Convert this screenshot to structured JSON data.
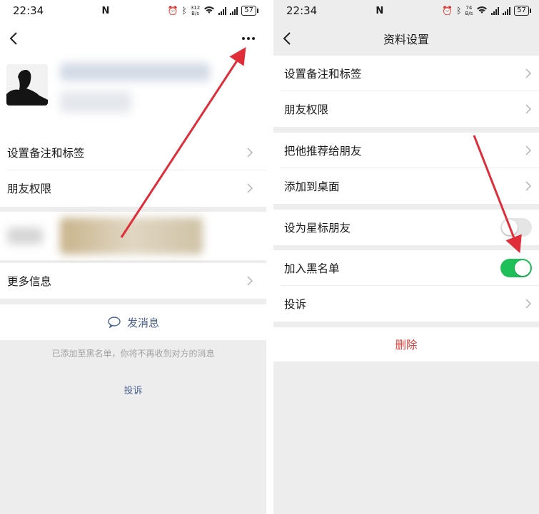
{
  "left_screen": {
    "status": {
      "time": "22:34",
      "speed_value": "312",
      "speed_unit": "B/s",
      "battery": "57"
    },
    "menu": [
      {
        "label": "设置备注和标签"
      },
      {
        "label": "朋友权限"
      }
    ],
    "more_info_label": "更多信息",
    "send_message_label": "发消息",
    "blacklist_notice": "已添加至黑名单，你将不再收到对方的消息",
    "complain_label": "投诉"
  },
  "right_screen": {
    "status": {
      "time": "22:34",
      "speed_value": "74",
      "speed_unit": "B/s",
      "battery": "57"
    },
    "title": "资料设置",
    "group1": [
      {
        "label": "设置备注和标签"
      },
      {
        "label": "朋友权限"
      }
    ],
    "group2": [
      {
        "label": "把他推荐给朋友"
      },
      {
        "label": "添加到桌面"
      }
    ],
    "star_friend": {
      "label": "设为星标朋友",
      "enabled": false
    },
    "blacklist": {
      "label": "加入黑名单",
      "enabled": true
    },
    "complain_label": "投诉",
    "delete_label": "删除"
  },
  "colors": {
    "annotation_arrow": "#e02d3a",
    "toggle_on": "#1fbf5a",
    "link": "#4a6190",
    "danger": "#e0403a"
  }
}
